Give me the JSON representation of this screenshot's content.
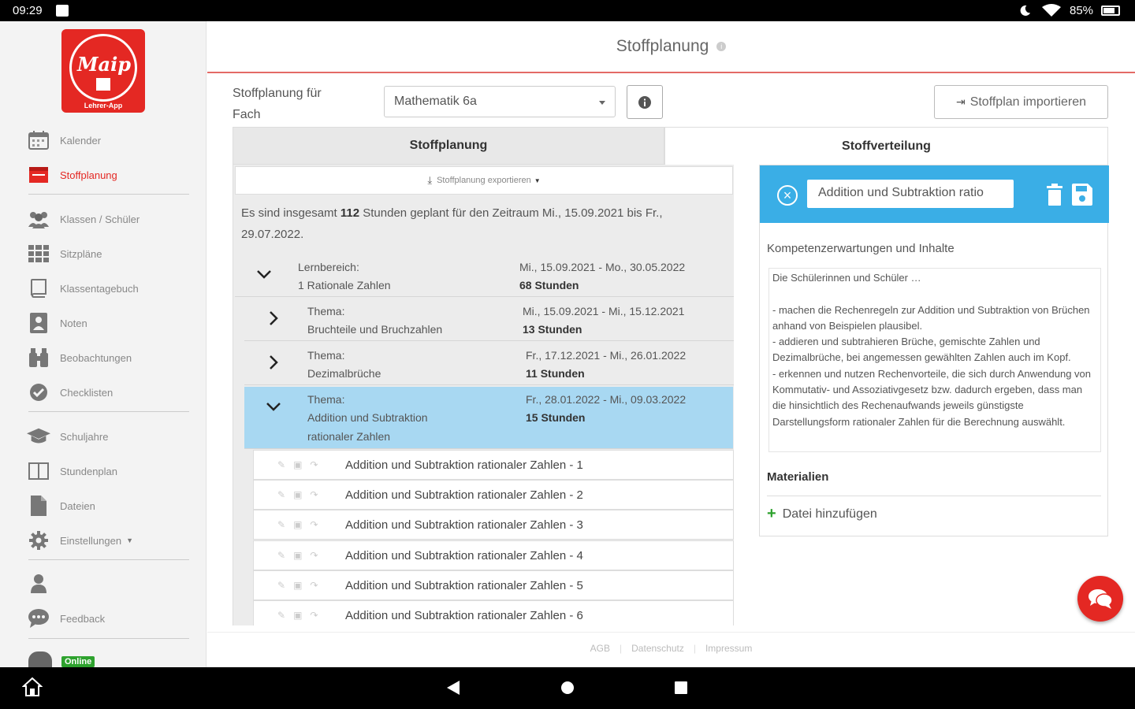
{
  "status_bar": {
    "time": "09:29",
    "battery": "85%"
  },
  "sidebar": {
    "logo_script": "Maip",
    "logo_caption": "Lehrer-App",
    "items": [
      {
        "label": "Kalender",
        "icon": "calendar-icon"
      },
      {
        "label": "Stoffplanung",
        "icon": "planning-icon",
        "active": true
      },
      {
        "label": "Klassen / Schüler",
        "icon": "users-icon"
      },
      {
        "label": "Sitzpläne",
        "icon": "grid-icon"
      },
      {
        "label": "Klassentagebuch",
        "icon": "book-icon"
      },
      {
        "label": "Noten",
        "icon": "grades-icon"
      },
      {
        "label": "Beobachtungen",
        "icon": "binoculars-icon"
      },
      {
        "label": "Checklisten",
        "icon": "check-circle-icon"
      },
      {
        "label": "Schuljahre",
        "icon": "graduation-cap-icon"
      },
      {
        "label": "Stundenplan",
        "icon": "timetable-icon"
      },
      {
        "label": "Dateien",
        "icon": "file-icon"
      },
      {
        "label": "Einstellungen",
        "icon": "gear-icon"
      },
      {
        "label": "",
        "icon": "user-icon"
      },
      {
        "label": "Feedback",
        "icon": "comment-icon"
      }
    ],
    "online_badge": "Online"
  },
  "header": {
    "title": "Stoffplanung",
    "info": "i"
  },
  "fach": {
    "label": "Stoffplanung für Fach",
    "selected": "Mathematik 6a"
  },
  "import_button": "Stoffplan importieren",
  "tabs": {
    "planung": "Stoffplanung",
    "verteilung": "Stoffverteilung"
  },
  "export_label": "Stoffplanung exportieren",
  "summary": {
    "prefix": "Es sind insgesamt ",
    "hours": "112",
    "suffix": " Stunden geplant für den Zeitraum Mi., 15.09.2021 bis Fr., 29.07.2022."
  },
  "lernbereich": {
    "label": "Lernbereich:",
    "name": "1 Rationale Zahlen",
    "dates": "Mi., 15.09.2021 - Mo., 30.05.2022",
    "hours": "68 Stunden"
  },
  "themen": [
    {
      "label": "Thema:",
      "name": "Bruchteile und Bruchzahlen",
      "name2": "",
      "dates": "Mi., 15.09.2021 - Mi., 15.12.2021",
      "hours": "13 Stunden"
    },
    {
      "label": "Thema:",
      "name": "Dezimalbrüche",
      "name2": "",
      "dates": "Fr., 17.12.2021 - Mi., 26.01.2022",
      "hours": "11 Stunden"
    },
    {
      "label": "Thema:",
      "name": "Addition und Subtraktion",
      "name2": "rationaler Zahlen",
      "dates": "Fr., 28.01.2022 - Mi., 09.03.2022",
      "hours": "15 Stunden"
    }
  ],
  "lessons": [
    "Addition und Subtraktion rationaler Zahlen - 1",
    "Addition und Subtraktion rationaler Zahlen - 2",
    "Addition und Subtraktion rationaler Zahlen - 3",
    "Addition und Subtraktion rationaler Zahlen - 4",
    "Addition und Subtraktion rationaler Zahlen - 5",
    "Addition und Subtraktion rationaler Zahlen - 6"
  ],
  "edit": {
    "name_value": "Addition und Subtraktion ratio"
  },
  "komp": {
    "label": "Kompetenzerwartungen und Inhalte",
    "text": "Die Schülerinnen und Schüler …\n\n- machen die Rechenregeln zur Addition und Subtraktion von Brüchen anhand von Beispielen plausibel.\n- addieren und subtrahieren Brüche, gemischte Zahlen und Dezimalbrüche, bei angemessen gewählten Zahlen auch im Kopf.\n- erkennen und nutzen Rechenvorteile, die sich durch Anwendung von Kommutativ- und Assoziativgesetz bzw. dadurch ergeben, dass man die hinsichtlich des Rechenaufwands jeweils günstigste Darstellungsform rationaler Zahlen für die Berechnung auswählt."
  },
  "materialien": {
    "label": "Materialien",
    "add": "Datei hinzufügen"
  },
  "footer": {
    "agb": "AGB",
    "datenschutz": "Datenschutz",
    "impressum": "Impressum"
  },
  "colors": {
    "brand": "#e42823",
    "selected_row": "#a8d8f2",
    "edit_bar": "#3aaee6",
    "online": "#2ea22e"
  }
}
